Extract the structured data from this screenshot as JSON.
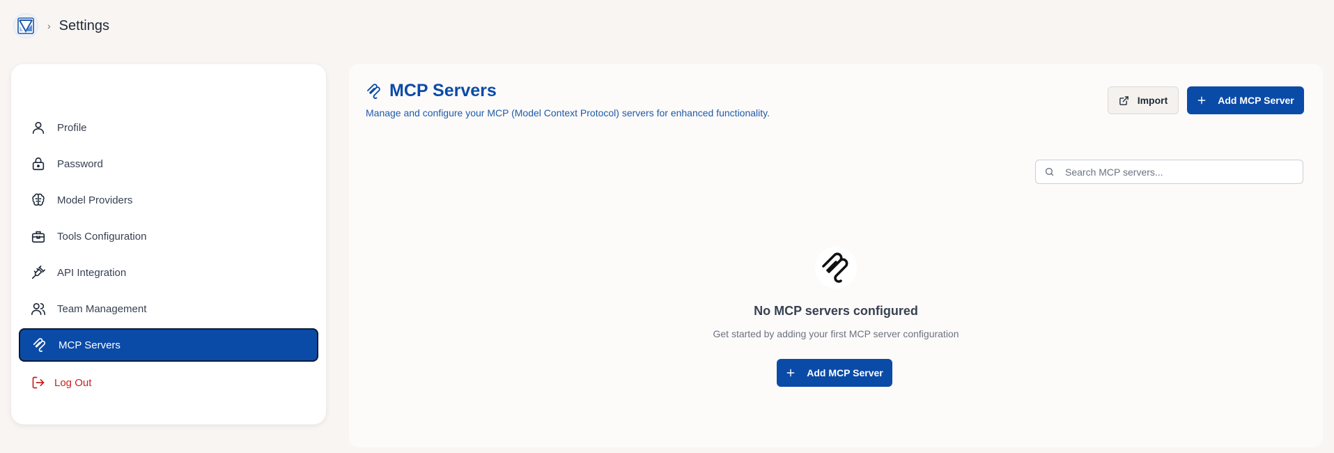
{
  "breadcrumb": {
    "title": "Settings"
  },
  "sidebar": {
    "items": [
      {
        "label": "Profile",
        "icon": "user-icon"
      },
      {
        "label": "Password",
        "icon": "lock-icon"
      },
      {
        "label": "Model Providers",
        "icon": "brain-icon"
      },
      {
        "label": "Tools Configuration",
        "icon": "toolbox-icon"
      },
      {
        "label": "API Integration",
        "icon": "plug-icon"
      },
      {
        "label": "Team Management",
        "icon": "users-icon"
      },
      {
        "label": "MCP Servers",
        "icon": "mcp-icon",
        "active": true
      }
    ],
    "logout_label": "Log Out"
  },
  "main": {
    "title": "MCP Servers",
    "subtitle": "Manage and configure your MCP (Model Context Protocol) servers for enhanced functionality.",
    "import_label": "Import",
    "add_label": "Add MCP Server",
    "search_placeholder": "Search MCP servers...",
    "empty_title": "No MCP servers configured",
    "empty_desc": "Get started by adding your first MCP server configuration",
    "empty_add_label": "Add MCP Server"
  },
  "colors": {
    "accent": "#0b4ba8",
    "logout": "#c81e1e",
    "background": "#f8f5f2"
  }
}
